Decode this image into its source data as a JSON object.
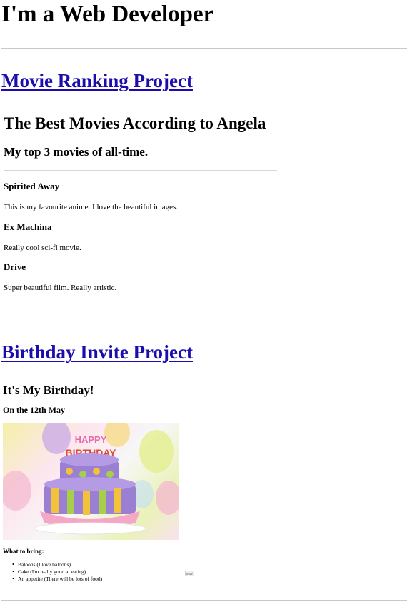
{
  "header": {
    "title": "I'm a Web Developer"
  },
  "movie_project": {
    "link_label": "Movie Ranking Project",
    "heading": "The Best Movies According to Angela",
    "subheading": "My top 3 movies of all-time.",
    "movies": [
      {
        "title": "Spirited Away",
        "description": "This is my favourite anime. I love the beautiful images."
      },
      {
        "title": "Ex Machina",
        "description": "Really cool sci-fi movie."
      },
      {
        "title": "Drive",
        "description": "Super beautiful film. Really artistic."
      }
    ]
  },
  "birthday_project": {
    "link_label": "Birthday Invite Project",
    "heading": "It's My Birthday!",
    "date_line": "On the 12th May",
    "image_text": "HAPPY BIRTHDAY",
    "bring_label": "What to bring:",
    "bring_items": [
      "Baloons (I love baloons)",
      "Cake (I'm really good at eating)",
      "An appetite (There will be lots of food)"
    ],
    "button_label": "RSVP"
  },
  "colors": {
    "link": "#1a0dab",
    "rule": "#c8c8c8",
    "cake_purple": "#9b7fd3",
    "cake_yellow": "#f2c23a",
    "cake_pink": "#f4a8c6"
  }
}
